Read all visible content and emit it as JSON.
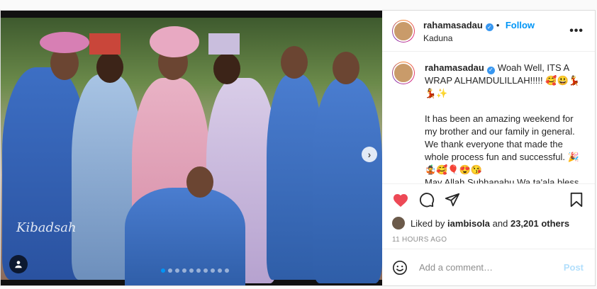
{
  "post": {
    "username": "rahamasadau",
    "follow_label": "Follow",
    "location": "Kaduna",
    "more_label": "•••",
    "watermark": "Kibadsah",
    "caption": {
      "username": "rahamasadau",
      "line1": "Woah Well, ITS A WRAP ALHAMDULILLAH!!!!! 🥰😃💃💃✨",
      "line2": "It has been an amazing weekend for my brother and our family in general. We thank everyone that made the whole process fun and successful. 🎉",
      "line3": "🤹🥰🎈😍😘",
      "line4": "May Allah Subhanahu Wa ta'ala bless their home.🧿✨"
    },
    "liked_by_prefix": "Liked by",
    "liked_by_user": "iambisola",
    "liked_by_suffix": "and",
    "liked_by_count": "23,201 others",
    "timestamp": "11 HOURS AGO",
    "comment_placeholder": "Add a comment…",
    "post_label": "Post",
    "carousel": {
      "count": 10,
      "active": 0
    }
  },
  "colors": {
    "accent": "#0095f6",
    "heart": "#ed4956",
    "verified": "#3897f0"
  },
  "icons": [
    "heart-icon",
    "comment-icon",
    "share-icon",
    "bookmark-icon",
    "emoji-icon",
    "user-tag-icon",
    "chevron-right-icon",
    "more-icon",
    "verified-icon"
  ]
}
